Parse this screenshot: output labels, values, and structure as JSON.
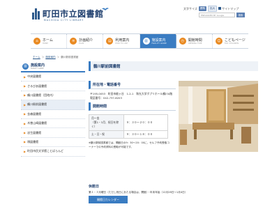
{
  "header": {
    "title": "町田市立図書館",
    "subtitle": "MACHIDA CITY LIBRARY",
    "font_size_label": "文字サイズ",
    "font_size_std": "標準",
    "font_size_large": "拡大",
    "sitemap": "サイトマップ",
    "search_placeholder": "ENHANCED BY Google",
    "search_button": "検索"
  },
  "gnav": [
    {
      "label": "ホーム",
      "sub": "HOME",
      "icon": "home-icon"
    },
    {
      "label": "計画紹介",
      "sub": "PLAN",
      "icon": "document-icon"
    },
    {
      "label": "利用案内",
      "sub": "HOW TO USE",
      "icon": "book-icon"
    },
    {
      "label": "施設案内",
      "sub": "FACILITY GUIDE",
      "icon": "building-icon"
    },
    {
      "label": "開館時間",
      "sub": "OPENING TIME",
      "icon": "clock-icon"
    },
    {
      "label": "こどもページ",
      "sub": "FOR CHILDREN",
      "icon": "child-icon"
    }
  ],
  "breadcrumb": [
    "ホーム",
    "施設案内",
    "鶴川駅前図書館"
  ],
  "sidebar": {
    "head_label": "施設案内",
    "head_sub": "FACILITY GUIDE",
    "items": [
      "中央図書館",
      "さるびあ図書館",
      "鶴川図書館（団地内）",
      "鶴川駅前図書館",
      "金森図書館",
      "木曽山崎図書館",
      "忠生図書館",
      "堺図書館",
      "町田市民文学館ことばらんど"
    ]
  },
  "main": {
    "title": "鶴川駅前図書館",
    "location_head": "所在地・電話番号",
    "address": "〒195-0053　町田市能ヶ谷　1-2-1　和光大学ポプリホール鶴川4階",
    "phone": "電話番号：042-737-8203",
    "hours_head": "開館時間",
    "hours": [
      {
        "day": "月～金\n（第1・3月、祝日を除く）",
        "time": "９：３０～２０：００"
      },
      {
        "day": "土・日・祝",
        "time": "９：３０～１８：００"
      }
    ],
    "note": "※鶴川駅前図書館では、開館日の9：30～20：00に、セルフ予約受取コーナーでの予約資料の受取が可能です。",
    "holiday_head": "休館日",
    "holiday_text": "第１・３月曜日（ただし祝日にあたる場合は、開館）・年末年始（12月28日～1月4日）",
    "calendar_button": "開館日カレンダー"
  }
}
